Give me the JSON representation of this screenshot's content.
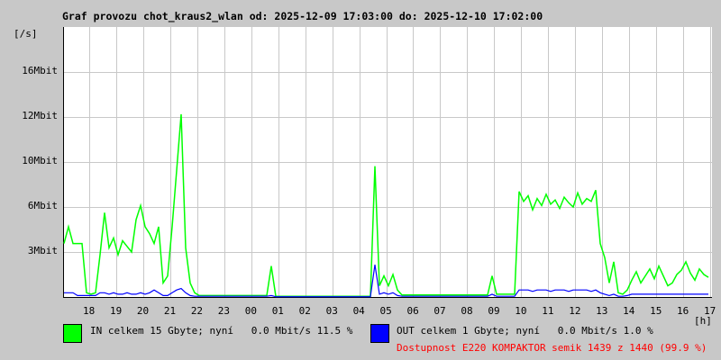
{
  "chart_data": {
    "type": "line",
    "title": "Graf provozu chot_kraus2_wlan od: 2025-12-09 17:03:00 do: 2025-12-10 17:02:00",
    "ylabel": "[/s]",
    "xlabel": "[h]",
    "ylim": [
      0,
      19.2
    ],
    "y_ticks": [
      {
        "value": 3.2,
        "label": "3Mbit"
      },
      {
        "value": 6.4,
        "label": "6Mbit"
      },
      {
        "value": 9.6,
        "label": "10Mbit"
      },
      {
        "value": 12.8,
        "label": "12Mbit"
      },
      {
        "value": 16.0,
        "label": "16Mbit"
      }
    ],
    "x_ticks": [
      "18",
      "19",
      "20",
      "21",
      "22",
      "23",
      "00",
      "01",
      "02",
      "03",
      "04",
      "05",
      "06",
      "07",
      "08",
      "09",
      "10",
      "11",
      "12",
      "13",
      "14",
      "15",
      "16",
      "17"
    ],
    "sample_minutes": 10,
    "grid": true,
    "series": [
      {
        "name": "IN",
        "color": "#00ff00",
        "values": [
          3.8,
          5.0,
          3.8,
          3.8,
          3.8,
          0.3,
          0.2,
          0.3,
          3.0,
          6.0,
          3.5,
          4.2,
          3.0,
          4.0,
          3.6,
          3.2,
          5.5,
          6.5,
          5.0,
          4.5,
          3.8,
          5.0,
          1.0,
          1.5,
          5.0,
          9.0,
          13.0,
          3.5,
          1.0,
          0.3,
          0.1,
          0.1,
          0.1,
          0.1,
          0.1,
          0.1,
          0.1,
          0.1,
          0.1,
          0.1,
          0.1,
          0.1,
          0.1,
          0.1,
          0.1,
          0.1,
          2.2,
          0.05,
          0.05,
          0.05,
          0.05,
          0.05,
          0.05,
          0.05,
          0.05,
          0.05,
          0.05,
          0.05,
          0.05,
          0.05,
          0.05,
          0.05,
          0.05,
          0.05,
          0.05,
          0.05,
          0.05,
          0.05,
          0.05,
          9.3,
          0.8,
          1.5,
          0.8,
          1.6,
          0.5,
          0.15,
          0.15,
          0.15,
          0.15,
          0.15,
          0.15,
          0.15,
          0.15,
          0.15,
          0.15,
          0.15,
          0.15,
          0.15,
          0.15,
          0.15,
          0.15,
          0.15,
          0.15,
          0.15,
          0.15,
          1.5,
          0.2,
          0.2,
          0.2,
          0.2,
          0.2,
          7.5,
          6.8,
          7.2,
          6.2,
          7.0,
          6.5,
          7.3,
          6.6,
          6.9,
          6.3,
          7.1,
          6.7,
          6.4,
          7.4,
          6.6,
          7.0,
          6.8,
          7.6,
          3.8,
          2.8,
          1.0,
          2.5,
          0.3,
          0.2,
          0.5,
          1.2,
          1.8,
          1.0,
          1.5,
          2.0,
          1.3,
          2.2,
          1.5,
          0.8,
          1.0,
          1.6,
          1.9,
          2.5,
          1.7,
          1.2,
          2.0,
          1.6,
          1.4
        ]
      },
      {
        "name": "OUT",
        "color": "#0000ff",
        "values": [
          0.3,
          0.3,
          0.3,
          0.1,
          0.1,
          0.1,
          0.1,
          0.1,
          0.3,
          0.3,
          0.2,
          0.3,
          0.2,
          0.2,
          0.3,
          0.2,
          0.2,
          0.3,
          0.2,
          0.3,
          0.5,
          0.3,
          0.1,
          0.1,
          0.3,
          0.5,
          0.6,
          0.3,
          0.1,
          0.05,
          0.05,
          0.05,
          0.05,
          0.05,
          0.05,
          0.05,
          0.05,
          0.05,
          0.05,
          0.05,
          0.05,
          0.05,
          0.05,
          0.05,
          0.05,
          0.05,
          0.1,
          0.02,
          0.02,
          0.02,
          0.02,
          0.02,
          0.02,
          0.02,
          0.02,
          0.02,
          0.02,
          0.02,
          0.02,
          0.02,
          0.02,
          0.02,
          0.02,
          0.02,
          0.02,
          0.02,
          0.02,
          0.02,
          0.02,
          2.3,
          0.2,
          0.3,
          0.2,
          0.3,
          0.1,
          0.05,
          0.05,
          0.05,
          0.05,
          0.05,
          0.05,
          0.05,
          0.05,
          0.05,
          0.05,
          0.05,
          0.05,
          0.05,
          0.05,
          0.05,
          0.05,
          0.05,
          0.05,
          0.05,
          0.05,
          0.2,
          0.05,
          0.05,
          0.05,
          0.05,
          0.05,
          0.5,
          0.5,
          0.5,
          0.4,
          0.5,
          0.5,
          0.5,
          0.4,
          0.5,
          0.5,
          0.5,
          0.4,
          0.5,
          0.5,
          0.5,
          0.5,
          0.4,
          0.5,
          0.3,
          0.2,
          0.1,
          0.2,
          0.05,
          0.05,
          0.1,
          0.2,
          0.2,
          0.2,
          0.2,
          0.2,
          0.2,
          0.2,
          0.2,
          0.2,
          0.2,
          0.2,
          0.2,
          0.2,
          0.2,
          0.2,
          0.2,
          0.2,
          0.2
        ]
      }
    ]
  },
  "legend": {
    "in_text": "IN celkem 15 Gbyte; nyní   0.0 Mbit/s 11.5 %",
    "out_text": "OUT celkem 1 Gbyte; nyní   0.0 Mbit/s 1.0 %",
    "availability": "Dostupnost E220 KOMPAKTOR semik 1439 z 1440 (99.9 %)",
    "availability_color": "#ff0000"
  }
}
